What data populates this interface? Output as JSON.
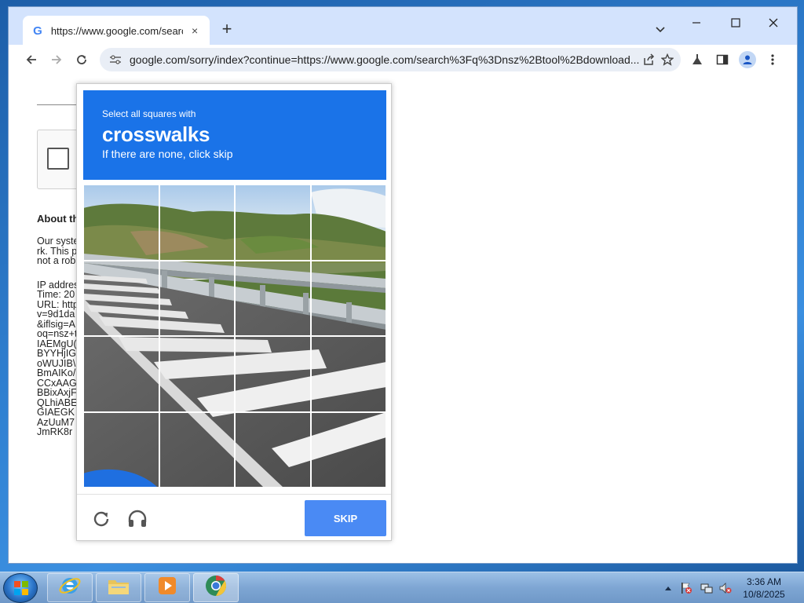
{
  "browser": {
    "tab_title": "https://www.google.com/search",
    "tab_close": "×",
    "new_tab": "+",
    "url": "google.com/sorry/index?continue=https://www.google.com/search%3Fq%3Dnsz%2Btool%2Bdownload...",
    "window_controls": {
      "minimize": "—",
      "maximize": "☐",
      "close": "✕"
    }
  },
  "background_page": {
    "heading": "About th",
    "lines": [
      "Our syste",
      "rk. This p",
      "not a rob",
      "",
      "IP addres",
      "Time: 20",
      "URL: http",
      "v=9d1da",
      "&iflsig=A",
      "oq=nsz+t",
      "IAEMgU(",
      "BYYHjIG",
      "oWUJIB\\",
      "BmAIKo/",
      "CCxAAG",
      "BBixAxjF",
      "QLhiABE",
      "GIAEGK",
      "AzUuM7",
      "JmRK8r"
    ]
  },
  "captcha": {
    "instruction_line1": "Select all squares with",
    "target": "crosswalks",
    "instruction_line2": "If there are none, click skip",
    "skip_label": "SKIP",
    "grid_rows": 4,
    "grid_cols": 4,
    "colors": {
      "header": "#1a73e8",
      "skip_button": "#4a8af4"
    }
  },
  "taskbar": {
    "time": "3:36 AM",
    "date": "10/8/2025"
  }
}
